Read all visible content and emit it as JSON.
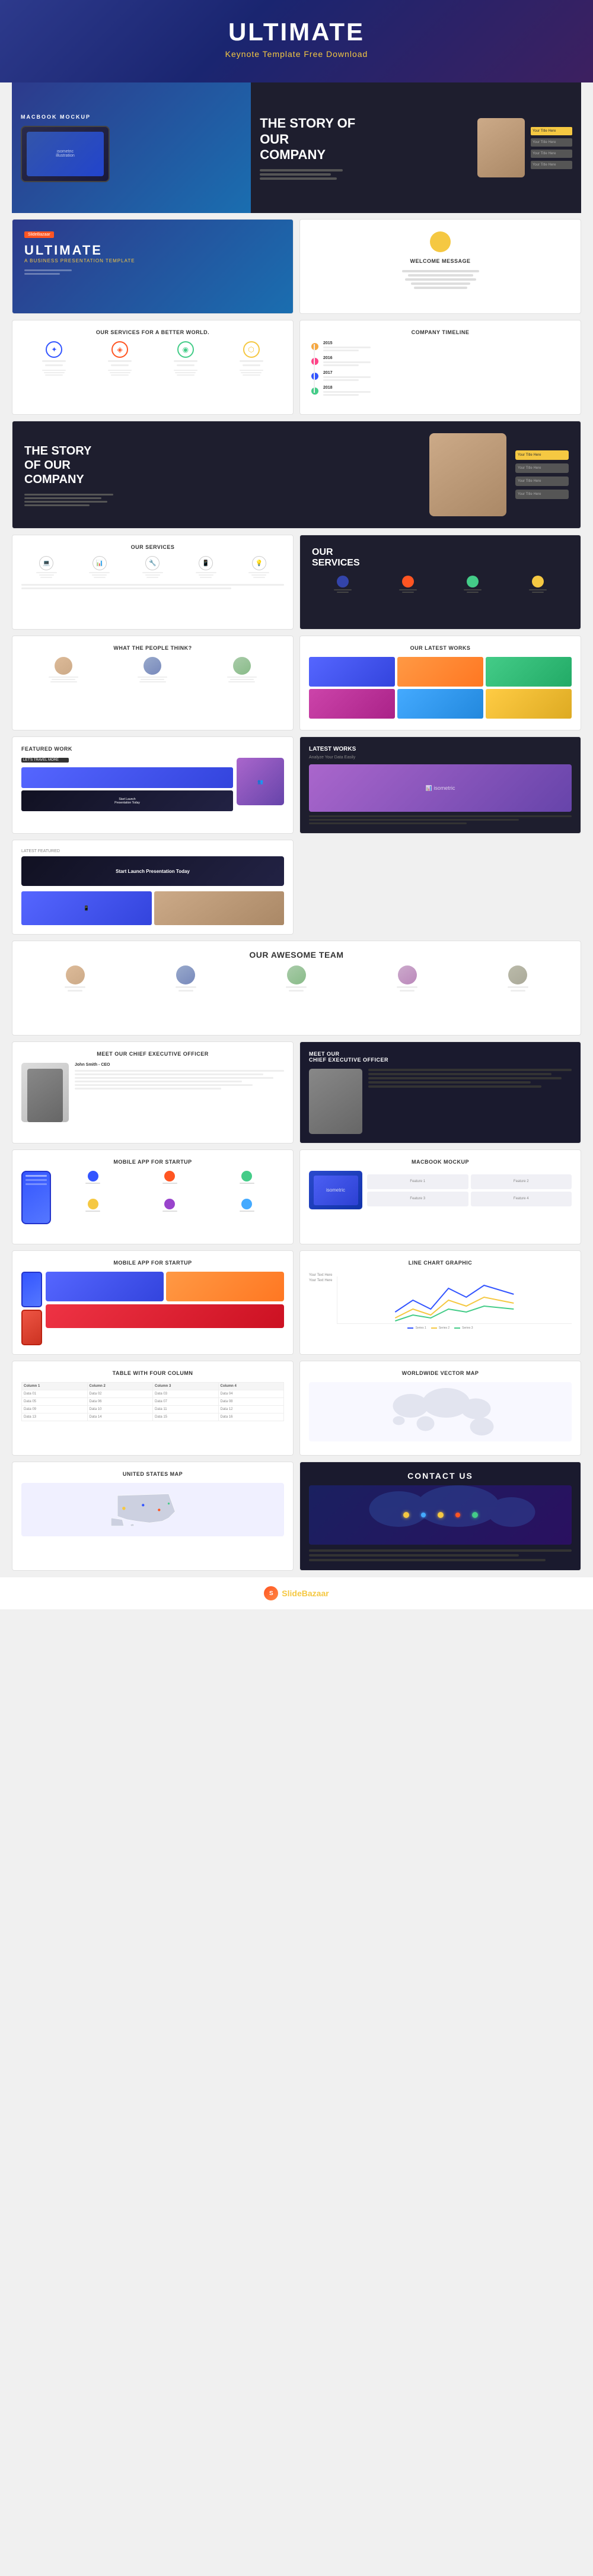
{
  "header": {
    "title": "ULTIMATE",
    "subtitle": "Keynote Template Free Download"
  },
  "hero": {
    "macbook_label": "MACBOOK MOCKUP",
    "story_title": "THE STORY OF OUR COMPANY"
  },
  "slides": [
    {
      "id": "ultimate",
      "type": "ultimate",
      "title": "ULTIMATE",
      "subtitle": "A BUSINESS PRESENTATION TEMPLATE"
    },
    {
      "id": "welcome",
      "type": "welcome",
      "title": "WELCOME MESSAGE"
    },
    {
      "id": "services-better",
      "type": "services-icons",
      "title": "Our Services For A Better World."
    },
    {
      "id": "timeline",
      "type": "timeline",
      "title": "COMPANY TIMELINE",
      "years": [
        "2015",
        "2016",
        "2017",
        "2018"
      ]
    },
    {
      "id": "story-dark",
      "type": "story-dark",
      "title": "THE STORY OF OUR COMPANY"
    },
    {
      "id": "services-white",
      "type": "services-white",
      "title": "OUR SERVICES"
    },
    {
      "id": "our-services-dark",
      "type": "services-dark",
      "title": "OUR SERVICES"
    },
    {
      "id": "what-people",
      "type": "what-people",
      "title": "WHAT THE PEOPLE THINK?"
    },
    {
      "id": "latest-works",
      "type": "latest-works",
      "title": "OUR LATEST WORKS"
    },
    {
      "id": "featured-work",
      "type": "featured",
      "title": "FEATURED WORK"
    },
    {
      "id": "latest-works-dark",
      "type": "latest-works-dark",
      "title": "LATEST WORKS"
    },
    {
      "id": "launch-pres",
      "type": "launch",
      "title": "Start Launch Presentation Today"
    },
    {
      "id": "awesome-team",
      "type": "team",
      "title": "OUR AWESOME TEAM"
    },
    {
      "id": "ceo-white",
      "type": "ceo",
      "title": "MEET OUR CHIEF EXECUTIVE OFFICER"
    },
    {
      "id": "ceo-dark",
      "type": "ceo-dark",
      "title": "MEET OUR CHIEF EXECUTIVE OFFICER"
    },
    {
      "id": "mobile-app-small",
      "type": "mobile-small",
      "title": "MOBILE APP FOR STARTUP"
    },
    {
      "id": "macbook-mockup",
      "type": "macbook",
      "title": "MACBOOK MOCKUP"
    },
    {
      "id": "mobile-app-full",
      "type": "mobile-full",
      "title": "MOBILE APP FOR STARTUP"
    },
    {
      "id": "line-chart",
      "type": "line-chart",
      "title": "LINE CHART GRAPHIC"
    },
    {
      "id": "table-four",
      "type": "table",
      "title": "TABLE WITH FOUR COLUMN",
      "headers": [
        "Col 1",
        "Col 2",
        "Col 3",
        "Col 4"
      ],
      "rows": [
        [
          "Data",
          "Data",
          "Data",
          "Data"
        ],
        [
          "Data",
          "Data",
          "Data",
          "Data"
        ],
        [
          "Data",
          "Data",
          "Data",
          "Data"
        ]
      ]
    },
    {
      "id": "world-map",
      "type": "world-map",
      "title": "WORLDWIDE VECTOR MAP"
    },
    {
      "id": "us-map",
      "type": "us-map",
      "title": "UNITED STATES MAP"
    },
    {
      "id": "contact",
      "type": "contact",
      "title": "CONTACT US"
    }
  ],
  "footer": {
    "logo_text": "Slide",
    "logo_accent": "Bazaar"
  }
}
